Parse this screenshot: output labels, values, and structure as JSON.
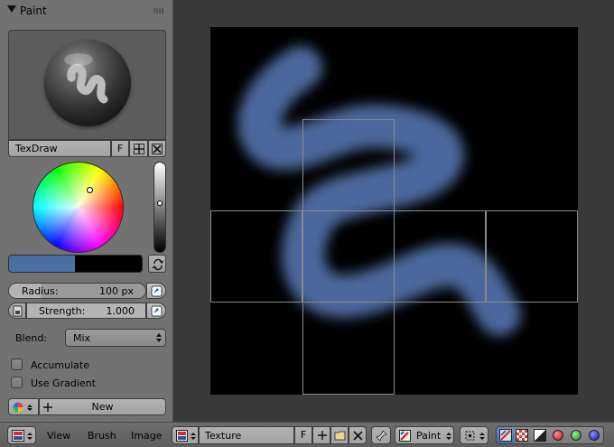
{
  "panel": {
    "title": "Paint",
    "brush_name": "TexDraw",
    "fake_user_label": "F",
    "primary_color": "#4a6fa5",
    "secondary_color": "#000000",
    "radius": {
      "label": "Radius:",
      "value": "100 px",
      "fraction": 0.23
    },
    "strength": {
      "label": "Strength:",
      "value": "1.000",
      "fraction": 1.0
    },
    "blend": {
      "label": "Blend:",
      "value": "Mix"
    },
    "accumulate_label": "Accumulate",
    "use_gradient_label": "Use Gradient",
    "new_texture_label": "New"
  },
  "footer": {
    "menu_view": "View",
    "menu_brush": "Brush",
    "menu_image": "Image",
    "texture_name": "Texture",
    "texture_fake_user": "F",
    "mode_label": "Paint"
  },
  "colors": {
    "stroke": "#4f6ea6",
    "grid": "#8a8a8a"
  }
}
